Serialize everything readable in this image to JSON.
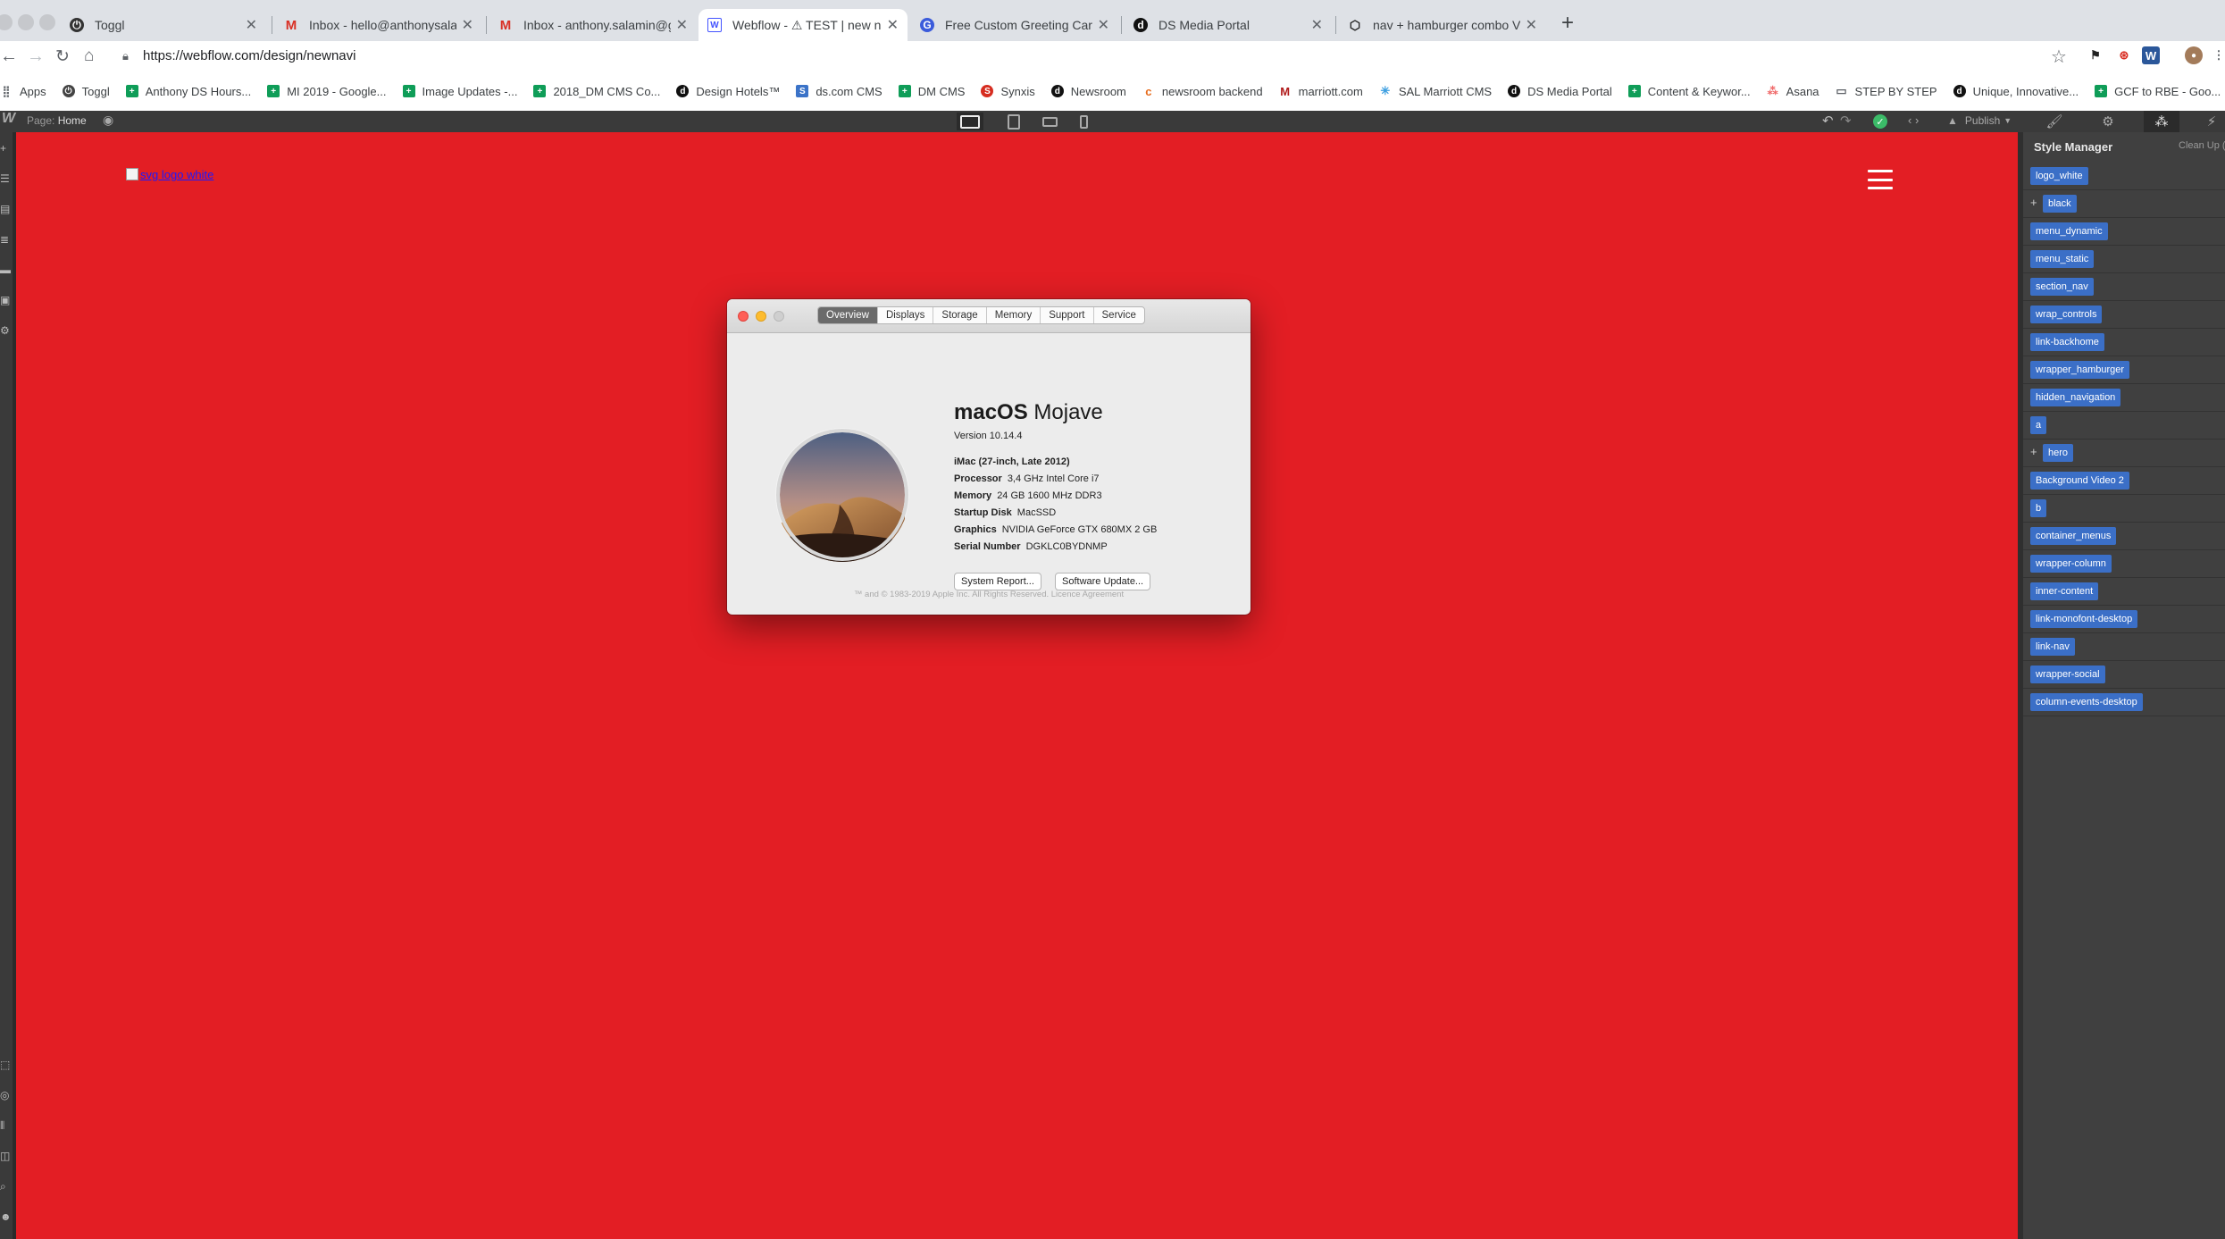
{
  "browser": {
    "tabs": [
      {
        "title": "Toggl",
        "favicon": "toggl-icon"
      },
      {
        "title": "Inbox - hello@anthonysalamin.",
        "favicon": "gmail-icon"
      },
      {
        "title": "Inbox - anthony.salamin@gmai",
        "favicon": "gmail-icon"
      },
      {
        "title": "Webflow - ⚠ TEST | new navi",
        "favicon": "webflow-icon",
        "active": true
      },
      {
        "title": "Free Custom Greeting Cards O",
        "favicon": "greeting-icon"
      },
      {
        "title": "DS Media Portal",
        "favicon": "ds-icon"
      },
      {
        "title": "nav + hamburger combo V",
        "favicon": "codepen-icon"
      }
    ],
    "url": "https://webflow.com/design/newnavi",
    "bookmarks": [
      {
        "label": "Apps",
        "icon": "apps-grid-icon",
        "color": "#5f6368"
      },
      {
        "label": "Toggl",
        "icon": "toggl-icon",
        "color": "#444"
      },
      {
        "label": "Anthony DS Hours...",
        "icon": "sheets-icon",
        "color": "#0f9d58"
      },
      {
        "label": "MI 2019 - Google...",
        "icon": "sheets-icon",
        "color": "#0f9d58"
      },
      {
        "label": "Image Updates -...",
        "icon": "sheets-icon",
        "color": "#0f9d58"
      },
      {
        "label": "2018_DM CMS Co...",
        "icon": "sheets-icon",
        "color": "#0f9d58"
      },
      {
        "label": "Design Hotels™",
        "icon": "ds-icon",
        "color": "#111"
      },
      {
        "label": "ds.com CMS",
        "icon": "ds-cms-icon",
        "color": "#3b73c8"
      },
      {
        "label": "DM CMS",
        "icon": "sheets-icon",
        "color": "#0f9d58"
      },
      {
        "label": "Synxis",
        "icon": "synxis-icon",
        "color": "#d62d20"
      },
      {
        "label": "Newsroom",
        "icon": "ds-icon",
        "color": "#111"
      },
      {
        "label": "newsroom backend",
        "icon": "c-icon",
        "color": "#e66b1b"
      },
      {
        "label": "marriott.com",
        "icon": "marriott-icon",
        "color": "#b01a1a"
      },
      {
        "label": "SAL Marriott CMS",
        "icon": "snowflake-icon",
        "color": "#3b9ee0"
      },
      {
        "label": "DS Media Portal",
        "icon": "ds-icon",
        "color": "#111"
      },
      {
        "label": "Content & Keywor...",
        "icon": "sheets-icon",
        "color": "#0f9d58"
      },
      {
        "label": "Asana",
        "icon": "asana-icon",
        "color": "#f06a6a"
      },
      {
        "label": "STEP BY STEP",
        "icon": "folder-icon",
        "color": "#5f6368"
      },
      {
        "label": "Unique, Innovative...",
        "icon": "ds-icon",
        "color": "#111"
      },
      {
        "label": "GCF to RBE - Goo...",
        "icon": "sheets-icon",
        "color": "#0f9d58"
      }
    ]
  },
  "designer": {
    "page_prefix": "Page:",
    "page_name": "Home",
    "publish_label": "Publish",
    "canvas": {
      "logo_alt": "svg logo white",
      "background_color": "#e31e24"
    },
    "style_manager": {
      "title": "Style Manager",
      "clean_up": "Clean Up (",
      "classes": [
        {
          "name": "logo_white",
          "expandable": false
        },
        {
          "name": "black",
          "expandable": true
        },
        {
          "name": "menu_dynamic",
          "expandable": false
        },
        {
          "name": "menu_static",
          "expandable": false
        },
        {
          "name": "section_nav",
          "expandable": false
        },
        {
          "name": "wrap_controls",
          "expandable": false
        },
        {
          "name": "link-backhome",
          "expandable": false
        },
        {
          "name": "wrapper_hamburger",
          "expandable": false
        },
        {
          "name": "hidden_navigation",
          "expandable": false
        },
        {
          "name": "a",
          "expandable": false
        },
        {
          "name": "hero",
          "expandable": true
        },
        {
          "name": "Background Video 2",
          "expandable": false
        },
        {
          "name": "b",
          "expandable": false
        },
        {
          "name": "container_menus",
          "expandable": false
        },
        {
          "name": "wrapper-column",
          "expandable": false
        },
        {
          "name": "inner-content",
          "expandable": false
        },
        {
          "name": "link-monofont-desktop",
          "expandable": false
        },
        {
          "name": "link-nav",
          "expandable": false
        },
        {
          "name": "wrapper-social",
          "expandable": false
        },
        {
          "name": "column-events-desktop",
          "expandable": false
        }
      ]
    }
  },
  "about_this_mac": {
    "tabs": [
      "Overview",
      "Displays",
      "Storage",
      "Memory",
      "Support",
      "Service"
    ],
    "active_tab": "Overview",
    "os_name_bold": "macOS",
    "os_name_light": "Mojave",
    "version": "Version 10.14.4",
    "model": "iMac (27-inch, Late 2012)",
    "specs": [
      {
        "key": "Processor",
        "value": "3,4 GHz Intel Core i7"
      },
      {
        "key": "Memory",
        "value": "24 GB 1600 MHz DDR3"
      },
      {
        "key": "Startup Disk",
        "value": "MacSSD"
      },
      {
        "key": "Graphics",
        "value": "NVIDIA GeForce GTX 680MX 2 GB"
      },
      {
        "key": "Serial Number",
        "value": "DGKLC0BYDNMP"
      }
    ],
    "buttons": {
      "system_report": "System Report...",
      "software_update": "Software Update..."
    },
    "legal": "™ and © 1983-2019 Apple Inc. All Rights Reserved. Licence Agreement"
  }
}
